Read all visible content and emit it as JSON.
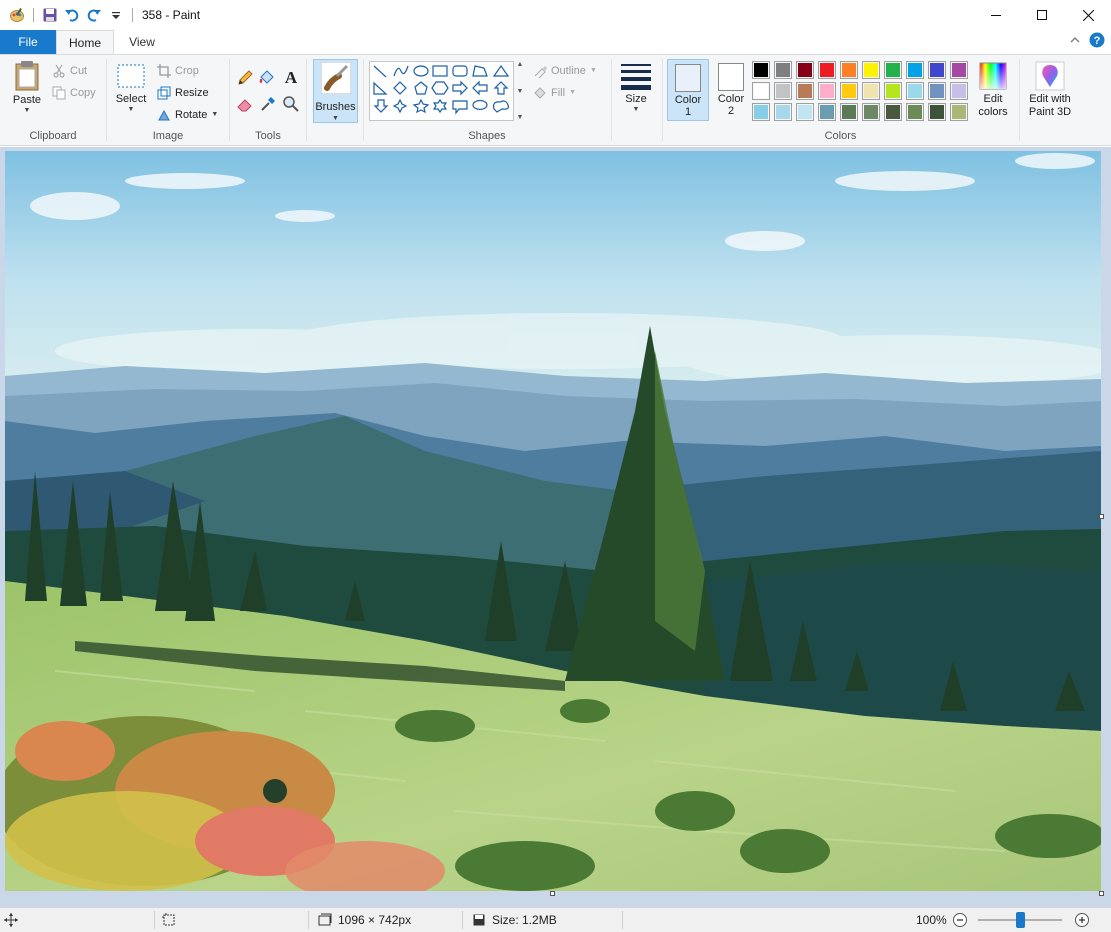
{
  "window": {
    "title": "358 - Paint",
    "controls": {
      "minimize_icon": "minimize-icon",
      "maximize_icon": "maximize-icon",
      "close_icon": "close-icon"
    }
  },
  "quick_access": [
    "paint-app-icon",
    "save-icon",
    "undo-icon",
    "redo-icon",
    "customize-qat-icon"
  ],
  "tabs": {
    "file": "File",
    "home": "Home",
    "view": "View",
    "active": "Home"
  },
  "ribbon": {
    "clipboard": {
      "paste": "Paste",
      "cut": "Cut",
      "copy": "Copy",
      "group": "Clipboard"
    },
    "image": {
      "select": "Select",
      "crop": "Crop",
      "resize": "Resize",
      "rotate": "Rotate",
      "group": "Image"
    },
    "tools": {
      "group": "Tools",
      "items": [
        "pencil-icon",
        "fill-bucket-icon",
        "text-icon",
        "eraser-icon",
        "color-picker-icon",
        "magnifier-icon"
      ]
    },
    "brushes": {
      "label": "Brushes"
    },
    "shapes": {
      "group": "Shapes",
      "outline": "Outline",
      "fill": "Fill",
      "items": [
        "line",
        "curve",
        "oval",
        "rectangle",
        "rounded-rectangle",
        "polygon",
        "triangle",
        "right-triangle",
        "diamond",
        "pentagon",
        "hexagon",
        "right-arrow",
        "left-arrow",
        "up-arrow",
        "down-arrow",
        "four-point-star",
        "five-point-star",
        "six-point-star",
        "rounded-callout",
        "oval-callout",
        "cloud-callout"
      ]
    },
    "size": {
      "label": "Size"
    },
    "colors": {
      "group": "Colors",
      "color1": "Color\n1",
      "color1_a": "Color",
      "color1_b": "1",
      "color2_a": "Color",
      "color2_b": "2",
      "color1_value": "#e8f0fa",
      "color2_value": "#ffffff",
      "edit": "Edit colors",
      "edit_a": "Edit",
      "edit_b": "colors",
      "paint3d_a": "Edit with",
      "paint3d_b": "Paint 3D",
      "palette": [
        [
          "#000000",
          "#7f7f7f",
          "#880015",
          "#ed1c24",
          "#ff7f27",
          "#fff200",
          "#22b14c",
          "#00a2e8",
          "#3f48cc",
          "#a349a4"
        ],
        [
          "#ffffff",
          "#c3c3c3",
          "#b97a57",
          "#ffaec9",
          "#ffc90e",
          "#efe4b0",
          "#b5e61d",
          "#99d9ea",
          "#7092be",
          "#c8bfe7"
        ],
        [
          "#87cde8",
          "#a8d8ec",
          "#c0e4f2",
          "#6c9cb0",
          "#5b7a55",
          "#6c8864",
          "#49583e",
          "#6b8a55",
          "#3d5238",
          "#a9b878"
        ]
      ]
    }
  },
  "canvas": {
    "description_icon": "landscape-painting"
  },
  "status": {
    "position_icon": "cursor-position-icon",
    "selection_icon": "selection-size-icon",
    "dimensions": "1096 × 742px",
    "size": "Size: 1.2MB",
    "zoom": "100%"
  }
}
